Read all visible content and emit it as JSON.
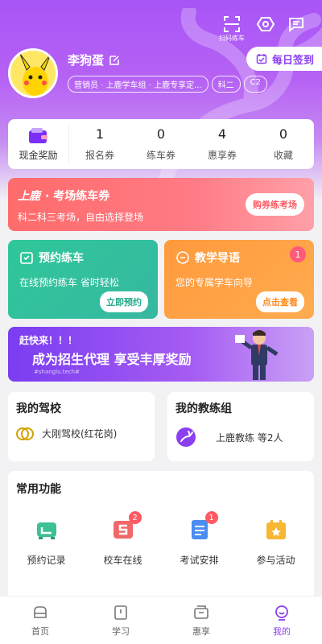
{
  "colors": {
    "accent": "#8a3ff0",
    "hero": "#a855f7"
  },
  "header": {
    "scan_label": "扫码练车",
    "username": "李狗蛋",
    "tags": [
      "营销员 · 上鹿学车组 · 上鹿专享定...",
      "科二",
      "C2"
    ],
    "checkin_label": "每日签到"
  },
  "stats": {
    "cash_label": "现金奖励",
    "items": [
      {
        "value": "1",
        "label": "报名券"
      },
      {
        "value": "0",
        "label": "练车券"
      },
      {
        "value": "4",
        "label": "惠享券"
      },
      {
        "value": "0",
        "label": "收藏"
      }
    ]
  },
  "exam_banner": {
    "brand": "上鹿",
    "title": "· 考场练车券",
    "subtitle": "科二科三考场，自由选择登场",
    "button": "购券练考场"
  },
  "booking": {
    "title": "预约练车",
    "desc": "在线预约练车 省时轻松",
    "button": "立即预约"
  },
  "guide": {
    "title": "教学导语",
    "desc": "您的专属学车向导",
    "button": "点击查看",
    "badge": "1"
  },
  "agent_banner": {
    "line1": "赶快来！！！",
    "line2": "成为招生代理 享受丰厚奖励",
    "watermark": "#shanglu.tech#"
  },
  "school": {
    "title": "我的驾校",
    "name": "大刚驾校(红花岗)"
  },
  "coach": {
    "title": "我的教练组",
    "name": "上鹿教练 等2人"
  },
  "common": {
    "title": "常用功能",
    "items": [
      {
        "label": "预约记录",
        "badge": ""
      },
      {
        "label": "校车在线",
        "badge": "2"
      },
      {
        "label": "考试安排",
        "badge": "1"
      },
      {
        "label": "参与活动",
        "badge": ""
      }
    ]
  },
  "tabbar": [
    {
      "label": "首页"
    },
    {
      "label": "学习"
    },
    {
      "label": "惠享"
    },
    {
      "label": "我的"
    }
  ]
}
